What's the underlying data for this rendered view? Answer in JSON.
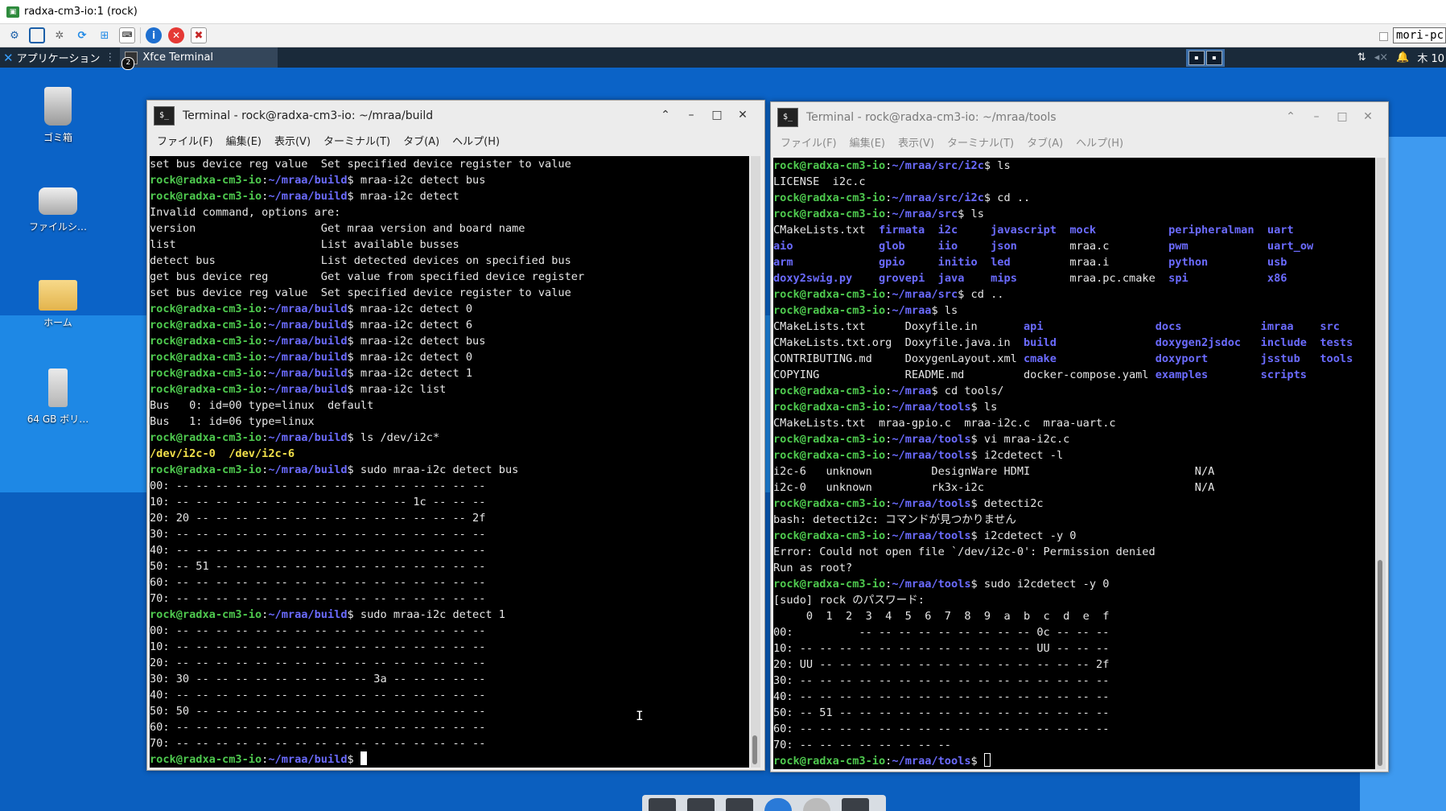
{
  "vnc": {
    "title": "radxa-cm3-io:1 (rock)",
    "host_field": "mori-pc",
    "toolbar_icons": [
      "options-icon",
      "fullscreen-icon",
      "settings-icon",
      "refresh-icon",
      "windows-key-icon",
      "ctrl-alt-del-icon",
      "info-icon",
      "close-connection-icon",
      "disconnect-icon"
    ]
  },
  "panel": {
    "apps_menu": "アプリケーション",
    "task_label": "Xfce Terminal",
    "task_badge": "2",
    "clock": "木 10"
  },
  "desktop": {
    "icons": [
      {
        "label": "ゴミ箱",
        "icon": "trash-icon"
      },
      {
        "label": "ファイルシ…",
        "icon": "filesystem-icon"
      },
      {
        "label": "ホーム",
        "icon": "home-folder-icon"
      },
      {
        "label": "64 GB ボリ…",
        "icon": "usb-drive-icon"
      }
    ]
  },
  "windows": {
    "left": {
      "title": "Terminal - rock@radxa-cm3-io: ~/mraa/build",
      "menu": [
        "ファイル(F)",
        "編集(E)",
        "表示(V)",
        "ターミナル(T)",
        "タブ(A)",
        "ヘルプ(H)"
      ],
      "lines": [
        [
          [
            "",
            "set bus device reg value  Set specified device register to value"
          ]
        ],
        [
          [
            "g",
            "rock@radxa-cm3-io"
          ],
          [
            "",
            ":"
          ],
          [
            "b",
            "~/mraa/build"
          ],
          [
            "",
            "$ mraa-i2c detect bus"
          ]
        ],
        [
          [
            "g",
            "rock@radxa-cm3-io"
          ],
          [
            "",
            ":"
          ],
          [
            "b",
            "~/mraa/build"
          ],
          [
            "",
            "$ mraa-i2c detect"
          ]
        ],
        [
          [
            "",
            "Invalid command, options are:"
          ]
        ],
        [
          [
            "",
            "version                   Get mraa version and board name"
          ]
        ],
        [
          [
            "",
            "list                      List available busses"
          ]
        ],
        [
          [
            "",
            "detect bus                List detected devices on specified bus"
          ]
        ],
        [
          [
            "",
            "get bus device reg        Get value from specified device register"
          ]
        ],
        [
          [
            "",
            "set bus device reg value  Set specified device register to value"
          ]
        ],
        [
          [
            "g",
            "rock@radxa-cm3-io"
          ],
          [
            "",
            ":"
          ],
          [
            "b",
            "~/mraa/build"
          ],
          [
            "",
            "$ mraa-i2c detect 0"
          ]
        ],
        [
          [
            "g",
            "rock@radxa-cm3-io"
          ],
          [
            "",
            ":"
          ],
          [
            "b",
            "~/mraa/build"
          ],
          [
            "",
            "$ mraa-i2c detect 6"
          ]
        ],
        [
          [
            "g",
            "rock@radxa-cm3-io"
          ],
          [
            "",
            ":"
          ],
          [
            "b",
            "~/mraa/build"
          ],
          [
            "",
            "$ mraa-i2c detect bus"
          ]
        ],
        [
          [
            "g",
            "rock@radxa-cm3-io"
          ],
          [
            "",
            ":"
          ],
          [
            "b",
            "~/mraa/build"
          ],
          [
            "",
            "$ mraa-i2c detect 0"
          ]
        ],
        [
          [
            "g",
            "rock@radxa-cm3-io"
          ],
          [
            "",
            ":"
          ],
          [
            "b",
            "~/mraa/build"
          ],
          [
            "",
            "$ mraa-i2c detect 1"
          ]
        ],
        [
          [
            "g",
            "rock@radxa-cm3-io"
          ],
          [
            "",
            ":"
          ],
          [
            "b",
            "~/mraa/build"
          ],
          [
            "",
            "$ mraa-i2c list"
          ]
        ],
        [
          [
            "",
            "Bus   0: id=00 type=linux  default"
          ]
        ],
        [
          [
            "",
            "Bus   1: id=06 type=linux"
          ]
        ],
        [
          [
            "g",
            "rock@radxa-cm3-io"
          ],
          [
            "",
            ":"
          ],
          [
            "b",
            "~/mraa/build"
          ],
          [
            "",
            "$ ls /dev/i2c*"
          ]
        ],
        [
          [
            "y",
            "/dev/i2c-0"
          ],
          [
            "",
            "  "
          ],
          [
            "y",
            "/dev/i2c-6"
          ]
        ],
        [
          [
            "g",
            "rock@radxa-cm3-io"
          ],
          [
            "",
            ":"
          ],
          [
            "b",
            "~/mraa/build"
          ],
          [
            "",
            "$ sudo mraa-i2c detect bus"
          ]
        ],
        [
          [
            "",
            "00: -- -- -- -- -- -- -- -- -- -- -- -- -- -- -- --"
          ]
        ],
        [
          [
            "",
            "10: -- -- -- -- -- -- -- -- -- -- -- -- 1c -- -- --"
          ]
        ],
        [
          [
            "",
            "20: 20 -- -- -- -- -- -- -- -- -- -- -- -- -- -- 2f"
          ]
        ],
        [
          [
            "",
            "30: -- -- -- -- -- -- -- -- -- -- -- -- -- -- -- --"
          ]
        ],
        [
          [
            "",
            "40: -- -- -- -- -- -- -- -- -- -- -- -- -- -- -- --"
          ]
        ],
        [
          [
            "",
            "50: -- 51 -- -- -- -- -- -- -- -- -- -- -- -- -- --"
          ]
        ],
        [
          [
            "",
            "60: -- -- -- -- -- -- -- -- -- -- -- -- -- -- -- --"
          ]
        ],
        [
          [
            "",
            "70: -- -- -- -- -- -- -- -- -- -- -- -- -- -- -- --"
          ]
        ],
        [
          [
            "g",
            "rock@radxa-cm3-io"
          ],
          [
            "",
            ":"
          ],
          [
            "b",
            "~/mraa/build"
          ],
          [
            "",
            "$ sudo mraa-i2c detect 1"
          ]
        ],
        [
          [
            "",
            "00: -- -- -- -- -- -- -- -- -- -- -- -- -- -- -- --"
          ]
        ],
        [
          [
            "",
            "10: -- -- -- -- -- -- -- -- -- -- -- -- -- -- -- --"
          ]
        ],
        [
          [
            "",
            "20: -- -- -- -- -- -- -- -- -- -- -- -- -- -- -- --"
          ]
        ],
        [
          [
            "",
            "30: 30 -- -- -- -- -- -- -- -- -- 3a -- -- -- -- --"
          ]
        ],
        [
          [
            "",
            "40: -- -- -- -- -- -- -- -- -- -- -- -- -- -- -- --"
          ]
        ],
        [
          [
            "",
            "50: 50 -- -- -- -- -- -- -- -- -- -- -- -- -- -- --"
          ]
        ],
        [
          [
            "",
            "60: -- -- -- -- -- -- -- -- -- -- -- -- -- -- -- --"
          ]
        ],
        [
          [
            "",
            "70: -- -- -- -- -- -- -- -- -- -- -- -- -- -- -- --"
          ]
        ],
        [
          [
            "g",
            "rock@radxa-cm3-io"
          ],
          [
            "",
            ":"
          ],
          [
            "b",
            "~/mraa/build"
          ],
          [
            "",
            "$ "
          ],
          [
            "cursor",
            ""
          ]
        ]
      ]
    },
    "right": {
      "title": "Terminal - rock@radxa-cm3-io: ~/mraa/tools",
      "menu": [
        "ファイル(F)",
        "編集(E)",
        "表示(V)",
        "ターミナル(T)",
        "タブ(A)",
        "ヘルプ(H)"
      ],
      "lines": [
        [
          [
            "g",
            "rock@radxa-cm3-io"
          ],
          [
            "",
            ":"
          ],
          [
            "b",
            "~/mraa/src/i2c"
          ],
          [
            "",
            "$ ls"
          ]
        ],
        [
          [
            "",
            "LICENSE  i2c.c"
          ]
        ],
        [
          [
            "g",
            "rock@radxa-cm3-io"
          ],
          [
            "",
            ":"
          ],
          [
            "b",
            "~/mraa/src/i2c"
          ],
          [
            "",
            "$ cd .."
          ]
        ],
        [
          [
            "g",
            "rock@radxa-cm3-io"
          ],
          [
            "",
            ":"
          ],
          [
            "b",
            "~/mraa/src"
          ],
          [
            "",
            "$ ls"
          ]
        ],
        [
          [
            "",
            "CMakeLists.txt  "
          ],
          [
            "b",
            "firmata"
          ],
          [
            "",
            "  "
          ],
          [
            "b",
            "i2c"
          ],
          [
            "",
            "     "
          ],
          [
            "b",
            "javascript"
          ],
          [
            "",
            "  "
          ],
          [
            "b",
            "mock"
          ],
          [
            "",
            "           "
          ],
          [
            "b",
            "peripheralman"
          ],
          [
            "",
            "  "
          ],
          [
            "b",
            "uart"
          ]
        ],
        [
          [
            "b",
            "aio"
          ],
          [
            "",
            "             "
          ],
          [
            "b",
            "glob"
          ],
          [
            "",
            "     "
          ],
          [
            "b",
            "iio"
          ],
          [
            "",
            "     "
          ],
          [
            "b",
            "json"
          ],
          [
            "",
            "        mraa.c         "
          ],
          [
            "b",
            "pwm"
          ],
          [
            "",
            "            "
          ],
          [
            "b",
            "uart_ow"
          ]
        ],
        [
          [
            "b",
            "arm"
          ],
          [
            "",
            "             "
          ],
          [
            "b",
            "gpio"
          ],
          [
            "",
            "     "
          ],
          [
            "b",
            "initio"
          ],
          [
            "",
            "  "
          ],
          [
            "b",
            "led"
          ],
          [
            "",
            "         mraa.i         "
          ],
          [
            "b",
            "python"
          ],
          [
            "",
            "         "
          ],
          [
            "b",
            "usb"
          ]
        ],
        [
          [
            "b",
            "doxy2swig.py"
          ],
          [
            "",
            "    "
          ],
          [
            "b",
            "grovepi"
          ],
          [
            "",
            "  "
          ],
          [
            "b",
            "java"
          ],
          [
            "",
            "    "
          ],
          [
            "b",
            "mips"
          ],
          [
            "",
            "        mraa.pc.cmake  "
          ],
          [
            "b",
            "spi"
          ],
          [
            "",
            "            "
          ],
          [
            "b",
            "x86"
          ]
        ],
        [
          [
            "g",
            "rock@radxa-cm3-io"
          ],
          [
            "",
            ":"
          ],
          [
            "b",
            "~/mraa/src"
          ],
          [
            "",
            "$ cd .."
          ]
        ],
        [
          [
            "g",
            "rock@radxa-cm3-io"
          ],
          [
            "",
            ":"
          ],
          [
            "b",
            "~/mraa"
          ],
          [
            "",
            "$ ls"
          ]
        ],
        [
          [
            "",
            "CMakeLists.txt      Doxyfile.in       "
          ],
          [
            "b",
            "api"
          ],
          [
            "",
            "                 "
          ],
          [
            "b",
            "docs"
          ],
          [
            "",
            "            "
          ],
          [
            "b",
            "imraa"
          ],
          [
            "",
            "    "
          ],
          [
            "b",
            "src"
          ]
        ],
        [
          [
            "",
            "CMakeLists.txt.org  Doxyfile.java.in  "
          ],
          [
            "b",
            "build"
          ],
          [
            "",
            "               "
          ],
          [
            "b",
            "doxygen2jsdoc"
          ],
          [
            "",
            "   "
          ],
          [
            "b",
            "include"
          ],
          [
            "",
            "  "
          ],
          [
            "b",
            "tests"
          ]
        ],
        [
          [
            "",
            "CONTRIBUTING.md     DoxygenLayout.xml "
          ],
          [
            "b",
            "cmake"
          ],
          [
            "",
            "               "
          ],
          [
            "b",
            "doxyport"
          ],
          [
            "",
            "        "
          ],
          [
            "b",
            "jsstub"
          ],
          [
            "",
            "   "
          ],
          [
            "b",
            "tools"
          ]
        ],
        [
          [
            "",
            "COPYING             README.md         docker-compose.yaml "
          ],
          [
            "b",
            "examples"
          ],
          [
            "",
            "        "
          ],
          [
            "b",
            "scripts"
          ]
        ],
        [
          [
            "g",
            "rock@radxa-cm3-io"
          ],
          [
            "",
            ":"
          ],
          [
            "b",
            "~/mraa"
          ],
          [
            "",
            "$ cd tools/"
          ]
        ],
        [
          [
            "g",
            "rock@radxa-cm3-io"
          ],
          [
            "",
            ":"
          ],
          [
            "b",
            "~/mraa/tools"
          ],
          [
            "",
            "$ ls"
          ]
        ],
        [
          [
            "",
            "CMakeLists.txt  mraa-gpio.c  mraa-i2c.c  mraa-uart.c"
          ]
        ],
        [
          [
            "g",
            "rock@radxa-cm3-io"
          ],
          [
            "",
            ":"
          ],
          [
            "b",
            "~/mraa/tools"
          ],
          [
            "",
            "$ vi mraa-i2c.c"
          ]
        ],
        [
          [
            "g",
            "rock@radxa-cm3-io"
          ],
          [
            "",
            ":"
          ],
          [
            "b",
            "~/mraa/tools"
          ],
          [
            "",
            "$ i2cdetect -l"
          ]
        ],
        [
          [
            "",
            "i2c-6   unknown         DesignWare HDMI                         N/A"
          ]
        ],
        [
          [
            "",
            "i2c-0   unknown         rk3x-i2c                                N/A"
          ]
        ],
        [
          [
            "g",
            "rock@radxa-cm3-io"
          ],
          [
            "",
            ":"
          ],
          [
            "b",
            "~/mraa/tools"
          ],
          [
            "",
            "$ detecti2c"
          ]
        ],
        [
          [
            "",
            "bash: detecti2c: コマンドが見つかりません"
          ]
        ],
        [
          [
            "g",
            "rock@radxa-cm3-io"
          ],
          [
            "",
            ":"
          ],
          [
            "b",
            "~/mraa/tools"
          ],
          [
            "",
            "$ i2cdetect -y 0"
          ]
        ],
        [
          [
            "",
            "Error: Could not open file `/dev/i2c-0': Permission denied"
          ]
        ],
        [
          [
            "",
            "Run as root?"
          ]
        ],
        [
          [
            "g",
            "rock@radxa-cm3-io"
          ],
          [
            "",
            ":"
          ],
          [
            "b",
            "~/mraa/tools"
          ],
          [
            "",
            "$ sudo i2cdetect -y 0"
          ]
        ],
        [
          [
            "",
            "[sudo] rock のパスワード:"
          ]
        ],
        [
          [
            "",
            "     0  1  2  3  4  5  6  7  8  9  a  b  c  d  e  f"
          ]
        ],
        [
          [
            "",
            "00:          -- -- -- -- -- -- -- -- -- 0c -- -- --"
          ]
        ],
        [
          [
            "",
            "10: -- -- -- -- -- -- -- -- -- -- -- -- UU -- -- --"
          ]
        ],
        [
          [
            "",
            "20: UU -- -- -- -- -- -- -- -- -- -- -- -- -- -- 2f"
          ]
        ],
        [
          [
            "",
            "30: -- -- -- -- -- -- -- -- -- -- -- -- -- -- -- --"
          ]
        ],
        [
          [
            "",
            "40: -- -- -- -- -- -- -- -- -- -- -- -- -- -- -- --"
          ]
        ],
        [
          [
            "",
            "50: -- 51 -- -- -- -- -- -- -- -- -- -- -- -- -- --"
          ]
        ],
        [
          [
            "",
            "60: -- -- -- -- -- -- -- -- -- -- -- -- -- -- -- --"
          ]
        ],
        [
          [
            "",
            "70: -- -- -- -- -- -- -- --"
          ]
        ],
        [
          [
            "g",
            "rock@radxa-cm3-io"
          ],
          [
            "",
            ":"
          ],
          [
            "b",
            "~/mraa/tools"
          ],
          [
            "",
            "$ "
          ],
          [
            "cursor-hollow",
            ""
          ]
        ]
      ]
    }
  },
  "colors": {
    "prompt_user": "#4ec94e",
    "prompt_path": "#6b6bff",
    "device_file": "#f2e04a",
    "terminal_bg": "#000000",
    "desktop_bg": "#0b63c7"
  }
}
